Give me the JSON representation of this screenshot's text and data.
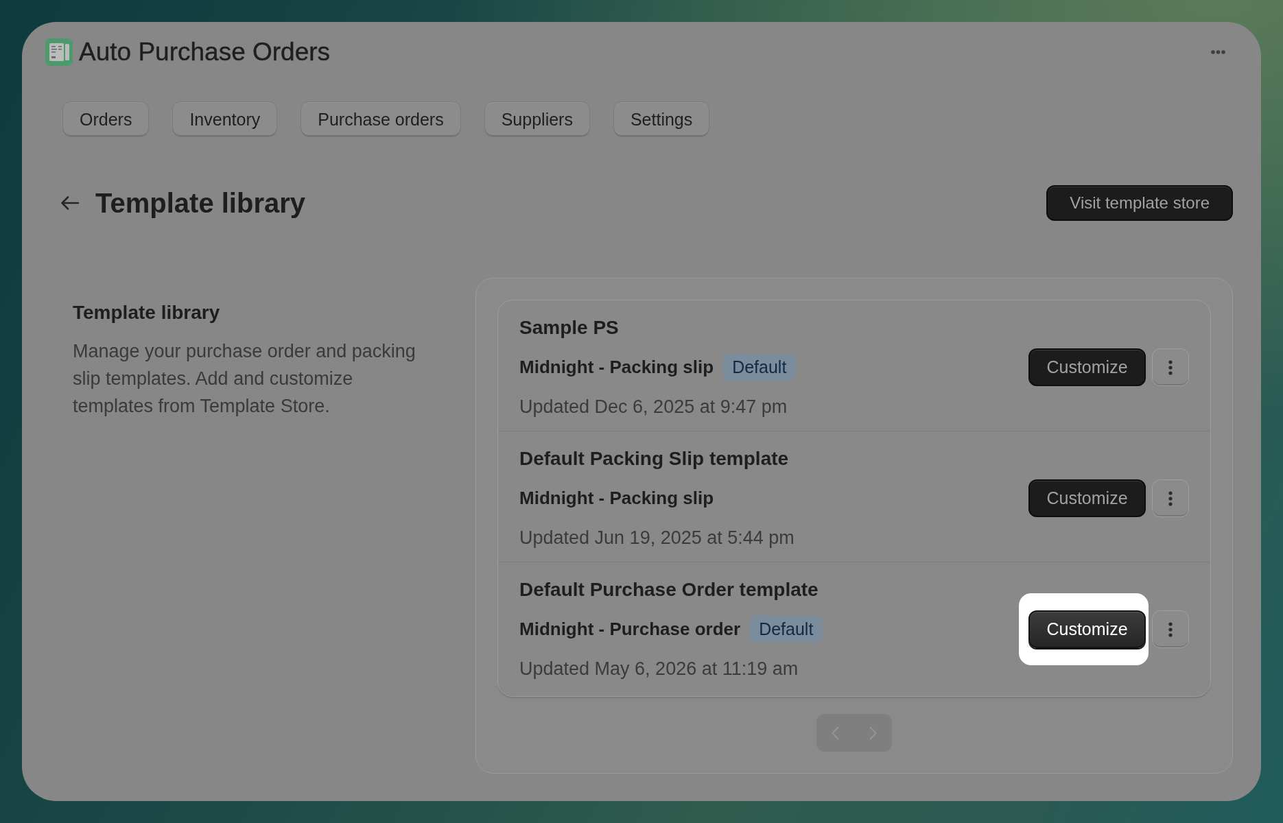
{
  "app": {
    "title": "Auto Purchase Orders"
  },
  "tabs": [
    {
      "label": "Orders",
      "selected": false
    },
    {
      "label": "Inventory",
      "selected": false
    },
    {
      "label": "Purchase orders",
      "selected": false
    },
    {
      "label": "Suppliers",
      "selected": false
    },
    {
      "label": "Settings",
      "selected": false
    }
  ],
  "page": {
    "title": "Template library",
    "primary_action": "Visit template store"
  },
  "section": {
    "title": "Template library",
    "description": "Manage your purchase order and packing slip templates. Add and customize templates from Template Store."
  },
  "templates": [
    {
      "name": "Sample PS",
      "layout": "Midnight - Packing slip",
      "badge": "Default",
      "updated": "Updated Dec 6, 2025 at 9:47 pm",
      "action": "Customize",
      "highlighted": false
    },
    {
      "name": "Default Packing Slip template",
      "layout": "Midnight - Packing slip",
      "updated": "Updated Jun 19, 2025 at 5:44 pm",
      "action": "Customize",
      "highlighted": false
    },
    {
      "name": "Default Purchase Order template",
      "layout": "Midnight - Purchase order",
      "badge": "Default",
      "updated": "Updated May 6, 2026 at 11:19 am",
      "action": "Customize",
      "highlighted": true
    }
  ],
  "pagination": {
    "previous_disabled": true,
    "next_disabled": true
  }
}
